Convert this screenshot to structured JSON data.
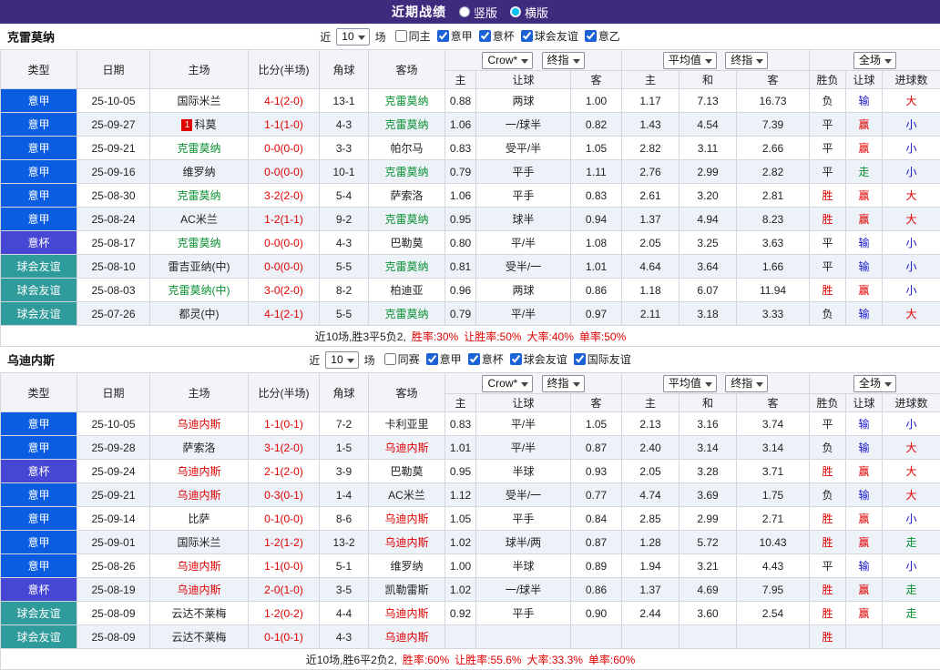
{
  "topbar": {
    "title": "近期战绩",
    "options": [
      {
        "label": "竖版",
        "selected": false
      },
      {
        "label": "横版",
        "selected": true
      }
    ]
  },
  "table_header": {
    "type": "类型",
    "date": "日期",
    "home": "主场",
    "score": "比分(半场)",
    "corner": "角球",
    "away": "客场",
    "dd_crow": "Crow*",
    "dd_final1": "终指",
    "dd_avg": "平均值",
    "dd_final2": "终指",
    "dd_full": "全场",
    "sub": [
      "主",
      "让球",
      "客",
      "主",
      "和",
      "客",
      "胜负",
      "让球",
      "进球数"
    ]
  },
  "colors": {
    "topbar_bg": "#3e2b7d",
    "radio_selected": "#00c2f0",
    "league_serie_a": "#0a5ce0",
    "league_cup": "#4747d6",
    "league_friendly": "#2f9b9b",
    "red": "#e00000",
    "green": "#089030",
    "blue": "#1717cc",
    "row_alt": "#edf2f9"
  },
  "sections": [
    {
      "team": "克雷莫纳",
      "filter": {
        "near_label": "近",
        "count": "10",
        "games_label": "场",
        "checkboxes": [
          {
            "label": "同主",
            "checked": false
          },
          {
            "label": "意甲",
            "checked": true
          },
          {
            "label": "意杯",
            "checked": true
          },
          {
            "label": "球会友谊",
            "checked": true
          },
          {
            "label": "意乙",
            "checked": true
          }
        ]
      },
      "rows": [
        {
          "lg": "意甲",
          "lgc": "a",
          "dt": "25-10-05",
          "rk": "",
          "hm": "国际米兰",
          "hmc": "",
          "sc": "4-1(2-0)",
          "cn": "13-1",
          "aw": "克雷莫纳",
          "awc": "g",
          "o": [
            "0.88",
            "两球",
            "1.00"
          ],
          "v": [
            "1.17",
            "7.13",
            "16.73"
          ],
          "res": [
            "负",
            "输",
            "大"
          ],
          "resc": [
            "",
            "b",
            "r"
          ]
        },
        {
          "lg": "意甲",
          "lgc": "a",
          "dt": "25-09-27",
          "rk": "1",
          "hm": "科莫",
          "hmc": "",
          "sc": "1-1(1-0)",
          "cn": "4-3",
          "aw": "克雷莫纳",
          "awc": "g",
          "o": [
            "1.06",
            "一/球半",
            "0.82"
          ],
          "v": [
            "1.43",
            "4.54",
            "7.39"
          ],
          "res": [
            "平",
            "赢",
            "小"
          ],
          "resc": [
            "",
            "r",
            "b"
          ]
        },
        {
          "lg": "意甲",
          "lgc": "a",
          "dt": "25-09-21",
          "rk": "",
          "hm": "克雷莫纳",
          "hmc": "g",
          "sc": "0-0(0-0)",
          "cn": "3-3",
          "aw": "帕尔马",
          "awc": "",
          "o": [
            "0.83",
            "受平/半",
            "1.05"
          ],
          "v": [
            "2.82",
            "3.11",
            "2.66"
          ],
          "res": [
            "平",
            "赢",
            "小"
          ],
          "resc": [
            "",
            "r",
            "b"
          ]
        },
        {
          "lg": "意甲",
          "lgc": "a",
          "dt": "25-09-16",
          "rk": "",
          "hm": "维罗纳",
          "hmc": "",
          "sc": "0-0(0-0)",
          "cn": "10-1",
          "aw": "克雷莫纳",
          "awc": "g",
          "o": [
            "0.79",
            "平手",
            "1.11"
          ],
          "v": [
            "2.76",
            "2.99",
            "2.82"
          ],
          "res": [
            "平",
            "走",
            "小"
          ],
          "resc": [
            "",
            "g",
            "b"
          ]
        },
        {
          "lg": "意甲",
          "lgc": "a",
          "dt": "25-08-30",
          "rk": "",
          "hm": "克雷莫纳",
          "hmc": "g",
          "sc": "3-2(2-0)",
          "cn": "5-4",
          "aw": "萨索洛",
          "awc": "",
          "o": [
            "1.06",
            "平手",
            "0.83"
          ],
          "v": [
            "2.61",
            "3.20",
            "2.81"
          ],
          "res": [
            "胜",
            "赢",
            "大"
          ],
          "resc": [
            "r",
            "r",
            "r"
          ]
        },
        {
          "lg": "意甲",
          "lgc": "a",
          "dt": "25-08-24",
          "rk": "",
          "hm": "AC米兰",
          "hmc": "",
          "sc": "1-2(1-1)",
          "cn": "9-2",
          "aw": "克雷莫纳",
          "awc": "g",
          "o": [
            "0.95",
            "球半",
            "0.94"
          ],
          "v": [
            "1.37",
            "4.94",
            "8.23"
          ],
          "res": [
            "胜",
            "赢",
            "大"
          ],
          "resc": [
            "r",
            "r",
            "r"
          ]
        },
        {
          "lg": "意杯",
          "lgc": "c",
          "dt": "25-08-17",
          "rk": "",
          "hm": "克雷莫纳",
          "hmc": "g",
          "sc": "0-0(0-0)",
          "cn": "4-3",
          "aw": "巴勒莫",
          "awc": "",
          "o": [
            "0.80",
            "平/半",
            "1.08"
          ],
          "v": [
            "2.05",
            "3.25",
            "3.63"
          ],
          "res": [
            "平",
            "输",
            "小"
          ],
          "resc": [
            "",
            "b",
            "b"
          ]
        },
        {
          "lg": "球会友谊",
          "lgc": "f",
          "dt": "25-08-10",
          "rk": "",
          "hm": "雷吉亚纳(中)",
          "hmc": "",
          "sc": "0-0(0-0)",
          "cn": "5-5",
          "aw": "克雷莫纳",
          "awc": "g",
          "o": [
            "0.81",
            "受半/一",
            "1.01"
          ],
          "v": [
            "4.64",
            "3.64",
            "1.66"
          ],
          "res": [
            "平",
            "输",
            "小"
          ],
          "resc": [
            "",
            "b",
            "b"
          ]
        },
        {
          "lg": "球会友谊",
          "lgc": "f",
          "dt": "25-08-03",
          "rk": "",
          "hm": "克雷莫纳(中)",
          "hmc": "g",
          "sc": "3-0(2-0)",
          "cn": "8-2",
          "aw": "柏迪亚",
          "awc": "",
          "o": [
            "0.96",
            "两球",
            "0.86"
          ],
          "v": [
            "1.18",
            "6.07",
            "11.94"
          ],
          "res": [
            "胜",
            "赢",
            "小"
          ],
          "resc": [
            "r",
            "r",
            "b"
          ]
        },
        {
          "lg": "球会友谊",
          "lgc": "f",
          "dt": "25-07-26",
          "rk": "",
          "hm": "都灵(中)",
          "hmc": "",
          "sc": "4-1(2-1)",
          "cn": "5-5",
          "aw": "克雷莫纳",
          "awc": "g",
          "o": [
            "0.79",
            "平/半",
            "0.97"
          ],
          "v": [
            "2.11",
            "3.18",
            "3.33"
          ],
          "res": [
            "负",
            "输",
            "大"
          ],
          "resc": [
            "",
            "b",
            "r"
          ]
        }
      ],
      "summary": {
        "prefix": "近10场,胜3平5负2,",
        "stats": [
          "胜率:30%",
          "让胜率:50%",
          "大率:40%",
          "单率:50%"
        ]
      }
    },
    {
      "team": "乌迪内斯",
      "filter": {
        "near_label": "近",
        "count": "10",
        "games_label": "场",
        "checkboxes": [
          {
            "label": "同赛",
            "checked": false
          },
          {
            "label": "意甲",
            "checked": true
          },
          {
            "label": "意杯",
            "checked": true
          },
          {
            "label": "球会友谊",
            "checked": true
          },
          {
            "label": "国际友谊",
            "checked": true
          }
        ]
      },
      "rows": [
        {
          "lg": "意甲",
          "lgc": "a",
          "dt": "25-10-05",
          "rk": "",
          "hm": "乌迪内斯",
          "hmc": "r",
          "sc": "1-1(0-1)",
          "cn": "7-2",
          "aw": "卡利亚里",
          "awc": "",
          "o": [
            "0.83",
            "平/半",
            "1.05"
          ],
          "v": [
            "2.13",
            "3.16",
            "3.74"
          ],
          "res": [
            "平",
            "输",
            "小"
          ],
          "resc": [
            "",
            "b",
            "b"
          ]
        },
        {
          "lg": "意甲",
          "lgc": "a",
          "dt": "25-09-28",
          "rk": "",
          "hm": "萨索洛",
          "hmc": "",
          "sc": "3-1(2-0)",
          "cn": "1-5",
          "aw": "乌迪内斯",
          "awc": "r",
          "o": [
            "1.01",
            "平/半",
            "0.87"
          ],
          "v": [
            "2.40",
            "3.14",
            "3.14"
          ],
          "res": [
            "负",
            "输",
            "大"
          ],
          "resc": [
            "",
            "b",
            "r"
          ]
        },
        {
          "lg": "意杯",
          "lgc": "c",
          "dt": "25-09-24",
          "rk": "",
          "hm": "乌迪内斯",
          "hmc": "r",
          "sc": "2-1(2-0)",
          "cn": "3-9",
          "aw": "巴勒莫",
          "awc": "",
          "o": [
            "0.95",
            "半球",
            "0.93"
          ],
          "v": [
            "2.05",
            "3.28",
            "3.71"
          ],
          "res": [
            "胜",
            "赢",
            "大"
          ],
          "resc": [
            "r",
            "r",
            "r"
          ]
        },
        {
          "lg": "意甲",
          "lgc": "a",
          "dt": "25-09-21",
          "rk": "",
          "hm": "乌迪内斯",
          "hmc": "r",
          "sc": "0-3(0-1)",
          "cn": "1-4",
          "aw": "AC米兰",
          "awc": "",
          "o": [
            "1.12",
            "受半/一",
            "0.77"
          ],
          "v": [
            "4.74",
            "3.69",
            "1.75"
          ],
          "res": [
            "负",
            "输",
            "大"
          ],
          "resc": [
            "",
            "b",
            "r"
          ]
        },
        {
          "lg": "意甲",
          "lgc": "a",
          "dt": "25-09-14",
          "rk": "",
          "hm": "比萨",
          "hmc": "",
          "sc": "0-1(0-0)",
          "cn": "8-6",
          "aw": "乌迪内斯",
          "awc": "r",
          "o": [
            "1.05",
            "平手",
            "0.84"
          ],
          "v": [
            "2.85",
            "2.99",
            "2.71"
          ],
          "res": [
            "胜",
            "赢",
            "小"
          ],
          "resc": [
            "r",
            "r",
            "b"
          ]
        },
        {
          "lg": "意甲",
          "lgc": "a",
          "dt": "25-09-01",
          "rk": "",
          "hm": "国际米兰",
          "hmc": "",
          "sc": "1-2(1-2)",
          "cn": "13-2",
          "aw": "乌迪内斯",
          "awc": "r",
          "o": [
            "1.02",
            "球半/两",
            "0.87"
          ],
          "v": [
            "1.28",
            "5.72",
            "10.43"
          ],
          "res": [
            "胜",
            "赢",
            "走"
          ],
          "resc": [
            "r",
            "r",
            "g"
          ]
        },
        {
          "lg": "意甲",
          "lgc": "a",
          "dt": "25-08-26",
          "rk": "",
          "hm": "乌迪内斯",
          "hmc": "r",
          "sc": "1-1(0-0)",
          "cn": "5-1",
          "aw": "维罗纳",
          "awc": "",
          "o": [
            "1.00",
            "半球",
            "0.89"
          ],
          "v": [
            "1.94",
            "3.21",
            "4.43"
          ],
          "res": [
            "平",
            "输",
            "小"
          ],
          "resc": [
            "",
            "b",
            "b"
          ]
        },
        {
          "lg": "意杯",
          "lgc": "c",
          "dt": "25-08-19",
          "rk": "",
          "hm": "乌迪内斯",
          "hmc": "r",
          "sc": "2-0(1-0)",
          "cn": "3-5",
          "aw": "凯勒雷斯",
          "awc": "",
          "o": [
            "1.02",
            "一/球半",
            "0.86"
          ],
          "v": [
            "1.37",
            "4.69",
            "7.95"
          ],
          "res": [
            "胜",
            "赢",
            "走"
          ],
          "resc": [
            "r",
            "r",
            "g"
          ]
        },
        {
          "lg": "球会友谊",
          "lgc": "f",
          "dt": "25-08-09",
          "rk": "",
          "hm": "云达不莱梅",
          "hmc": "",
          "sc": "1-2(0-2)",
          "cn": "4-4",
          "aw": "乌迪内斯",
          "awc": "r",
          "o": [
            "0.92",
            "平手",
            "0.90"
          ],
          "v": [
            "2.44",
            "3.60",
            "2.54"
          ],
          "res": [
            "胜",
            "赢",
            "走"
          ],
          "resc": [
            "r",
            "r",
            "g"
          ]
        },
        {
          "lg": "球会友谊",
          "lgc": "f",
          "dt": "25-08-09",
          "rk": "",
          "hm": "云达不莱梅",
          "hmc": "",
          "sc": "0-1(0-1)",
          "cn": "4-3",
          "aw": "乌迪内斯",
          "awc": "r",
          "o": [
            "",
            "",
            ""
          ],
          "v": [
            "",
            "",
            ""
          ],
          "res": [
            "胜",
            "",
            ""
          ],
          "resc": [
            "r",
            "",
            ""
          ]
        }
      ],
      "summary": {
        "prefix": "近10场,胜6平2负2,",
        "stats": [
          "胜率:60%",
          "让胜率:55.6%",
          "大率:33.3%",
          "单率:60%"
        ]
      }
    }
  ]
}
